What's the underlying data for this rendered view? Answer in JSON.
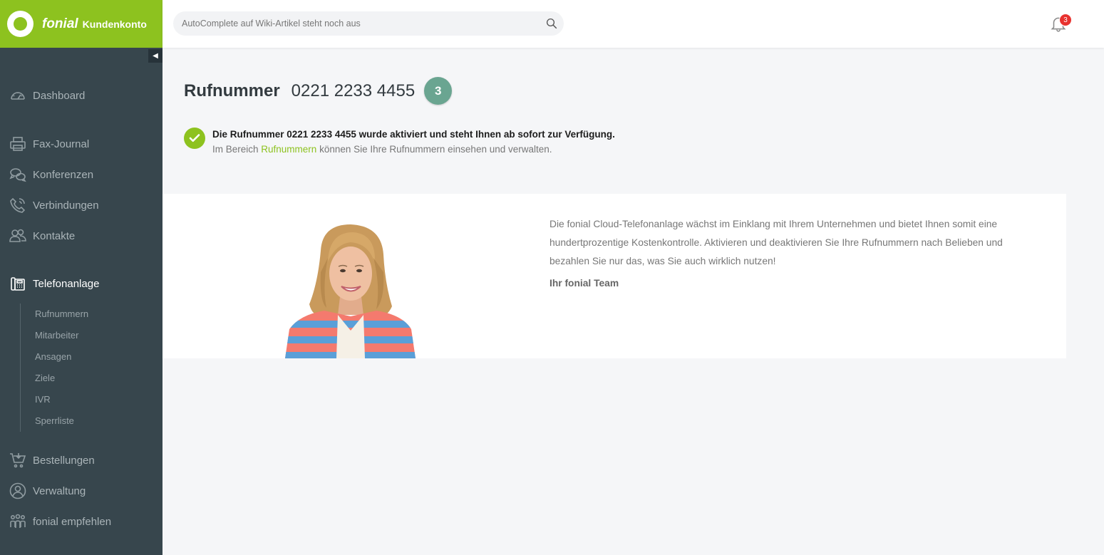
{
  "brand": {
    "name": "fonial",
    "subtitle": "Kundenkonto",
    "color": "#8dc21f"
  },
  "search": {
    "placeholder": "AutoComplete auf Wiki-Artikel steht noch aus"
  },
  "notifications": {
    "count": "3"
  },
  "sidebar": {
    "collapse_icon": "◀",
    "items": [
      {
        "label": "Dashboard",
        "icon": "speedometer-icon"
      },
      {
        "label": "Fax-Journal",
        "icon": "printer-icon"
      },
      {
        "label": "Konferenzen",
        "icon": "chat-bubbles-icon"
      },
      {
        "label": "Verbindungen",
        "icon": "phone-icon"
      },
      {
        "label": "Kontakte",
        "icon": "contacts-icon"
      },
      {
        "label": "Telefonanlage",
        "icon": "desk-phone-icon",
        "active": true
      },
      {
        "label": "Bestellungen",
        "icon": "cart-icon"
      },
      {
        "label": "Verwaltung",
        "icon": "user-circle-icon"
      },
      {
        "label": "fonial empfehlen",
        "icon": "people-icon"
      }
    ],
    "subitems": [
      "Rufnummern",
      "Mitarbeiter",
      "Ansagen",
      "Ziele",
      "IVR",
      "Sperrliste"
    ]
  },
  "main": {
    "heading_label": "Rufnummer",
    "heading_number": "0221 2233 4455",
    "heading_badge": "3",
    "notice": {
      "title": "Die Rufnummer 0221 2233 4455 wurde aktiviert und steht Ihnen ab sofort zur Verfügung.",
      "text_before": "Im Bereich ",
      "link": "Rufnummern",
      "text_after": " können Sie Ihre Rufnummern einsehen und verwalten."
    },
    "promo": {
      "text": "Die fonial Cloud-Telefonanlage wächst im Einklang mit Ihrem Unternehmen und bietet Ihnen somit eine hundertprozentige Kostenkontrolle. Aktivieren und deaktivieren Sie Ihre Rufnummern nach Belieben und bezahlen Sie nur das, was Sie auch wirklich nutzen!",
      "signature": "Ihr fonial Team"
    }
  }
}
